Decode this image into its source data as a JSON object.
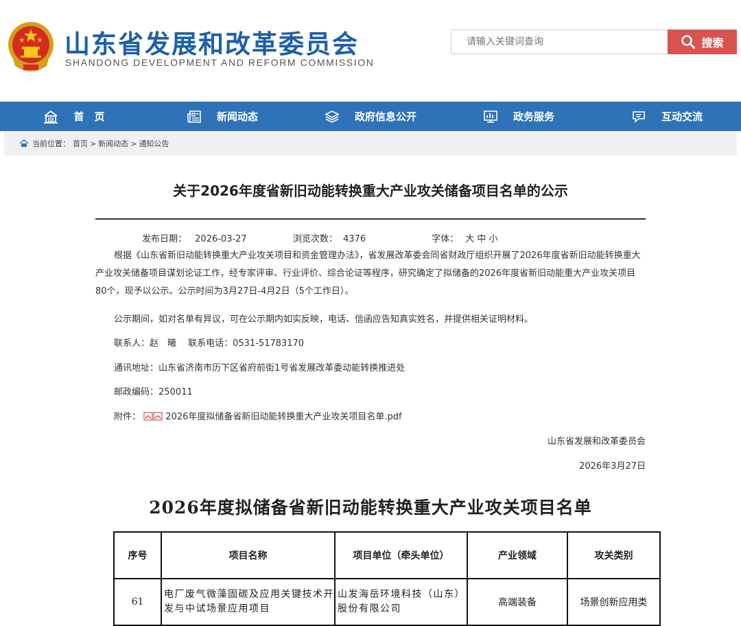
{
  "site": {
    "title": "山东省发展和改革委员会",
    "subtitle": "SHANDONG DEVELOPMENT AND REFORM COMMISSION"
  },
  "search": {
    "placeholder": "请输入关键词查询",
    "button_label": "搜索"
  },
  "nav": {
    "items": [
      {
        "label": "首　页",
        "icon": "home-icon"
      },
      {
        "label": "新闻动态",
        "icon": "news-icon"
      },
      {
        "label": "政府信息公开",
        "icon": "layers-icon"
      },
      {
        "label": "政务服务",
        "icon": "chart-monitor-icon"
      },
      {
        "label": "互动交流",
        "icon": "chat-icon"
      }
    ]
  },
  "breadcrumb": {
    "prefix": "当前位置：",
    "items": [
      "首页",
      "新闻动态",
      "通知公告"
    ],
    "separator": ">"
  },
  "article": {
    "title": "关于2026年度省新旧动能转换重大产业攻关储备项目名单的公示",
    "meta": {
      "date_label": "发布日期：",
      "date": "2026-03-27",
      "views_label": "浏览次数：",
      "views": "4376",
      "font_label": "字体：",
      "font_sizes": [
        "大",
        "中",
        "小"
      ]
    },
    "paragraph1": "根据《山东省新旧动能转换重大产业攻关项目和资金管理办法》，省发展改革委会同省财政厅组织开展了2026年度省新旧动能转换重大产业攻关储备项目谋划论证工作，经专家评审、行业评价、综合论证等程序，研究确定了拟储备的2026年度省新旧动能重大产业攻关项目80个，现予以公示。公示时间为3月27日-4月2日（5个工作日）。",
    "paragraph2": "公示期间，如对名单有异议，可在公示期内如实反映，电话、信函应告知真实姓名，并提供相关证明材料。",
    "contact": "联系人：赵　曦　 联系电话：0531-51783170",
    "address": "通讯地址：山东省济南市历下区省府前街1号省发展改革委动能转换推进处",
    "postcode": "邮政编码：250011",
    "attachment_label": "附件：",
    "attachment_file": "2026年度拟储备省新旧动能转换重大产业攻关项目名单.pdf",
    "signature": "山东省发展和改革委员会",
    "sign_date": "2026年3月27日"
  },
  "table": {
    "title": "2026年度拟储备省新旧动能转换重大产业攻关项目名单",
    "headers": [
      "序号",
      "项目名称",
      "项目单位（牵头单位）",
      "产业领域",
      "攻关类别"
    ],
    "rows": [
      {
        "no": "61",
        "name": "电厂废气微藻固碳及应用关键技术开发与中试场景应用项目",
        "unit": "山发海岳环境科技（山东）股份有限公司",
        "field": "高端装备",
        "category": "场景创新应用类"
      }
    ]
  },
  "colors": {
    "brand_blue": "#1d5fa8",
    "nav_blue": "#2e73b8",
    "search_red": "#d9534f"
  }
}
